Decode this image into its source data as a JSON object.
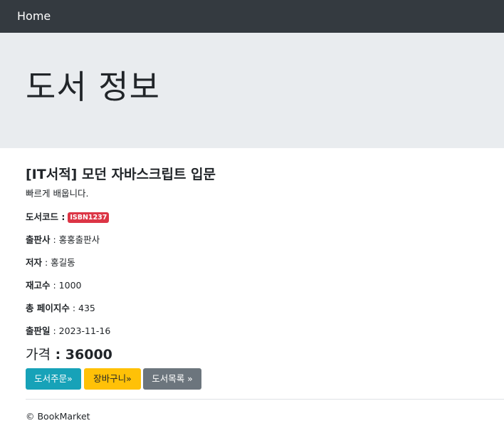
{
  "navbar": {
    "home_label": "Home"
  },
  "jumbotron": {
    "title": "도서 정보"
  },
  "book": {
    "title": "[IT서적] 모던 자바스크립트 입문",
    "description": "빠르게 배웁니다.",
    "code_label": "도서코드 :",
    "code_value": "ISBN1237",
    "publisher_label": "출판사",
    "publisher_value": " : 홍홍출판사",
    "author_label": "저자",
    "author_value": " : 홍길동",
    "stock_label": "재고수",
    "stock_value": " : 1000",
    "pages_label": "총 페이지수",
    "pages_value": " : 435",
    "release_label": "출판일",
    "release_value": " : 2023-11-16",
    "price_label": "가격",
    "price_value": " : 36000"
  },
  "buttons": {
    "order": "도서주문»",
    "cart": "장바구니»",
    "list": "도서목록 »"
  },
  "footer": {
    "copyright": "© BookMarket"
  },
  "colors": {
    "navbar": "#343a40",
    "jumbotron": "#e9ecef",
    "badge": "#dc3545",
    "order_button": "#17a2b8",
    "cart_button": "#ffc107",
    "list_button": "#6c757d"
  }
}
